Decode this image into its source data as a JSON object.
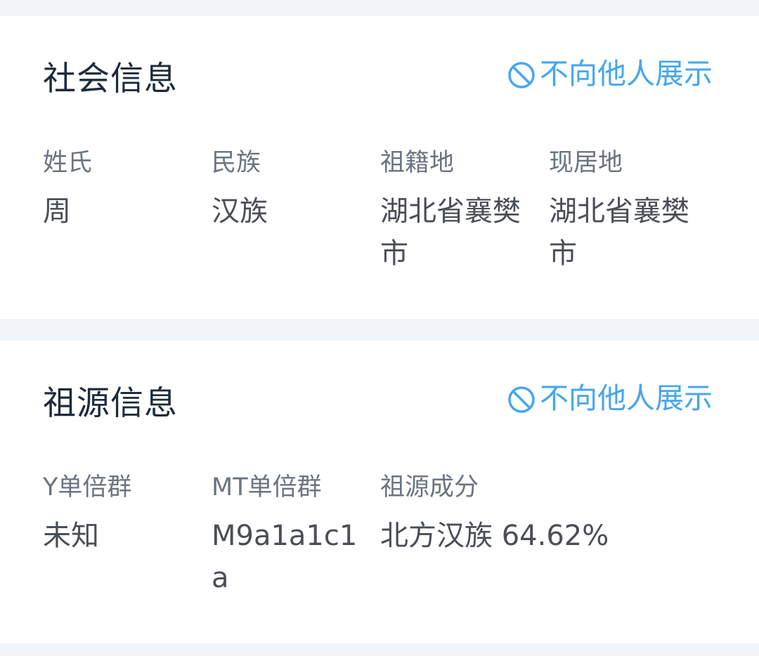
{
  "social": {
    "title": "社会信息",
    "privacy_label": "不向他人展示",
    "fields": [
      {
        "label": "姓氏",
        "value": "周"
      },
      {
        "label": "民族",
        "value": "汉族"
      },
      {
        "label": "祖籍地",
        "value": "湖北省襄樊市"
      },
      {
        "label": "现居地",
        "value": "湖北省襄樊市"
      }
    ]
  },
  "ancestry": {
    "title": "祖源信息",
    "privacy_label": "不向他人展示",
    "fields": [
      {
        "label": "Y单倍群",
        "value": "未知"
      },
      {
        "label": "MT单倍群",
        "value": "M9a1a1c1a"
      },
      {
        "label": "祖源成分",
        "value": "北方汉族 64.62%"
      }
    ]
  },
  "colors": {
    "accent": "#45a6ef",
    "title": "#1d2b3c",
    "label": "#6b7480",
    "value": "#4a4f56",
    "background": "#f1f4f7",
    "card": "#ffffff"
  },
  "icons": {
    "privacy": "no-entry-circle-icon"
  }
}
